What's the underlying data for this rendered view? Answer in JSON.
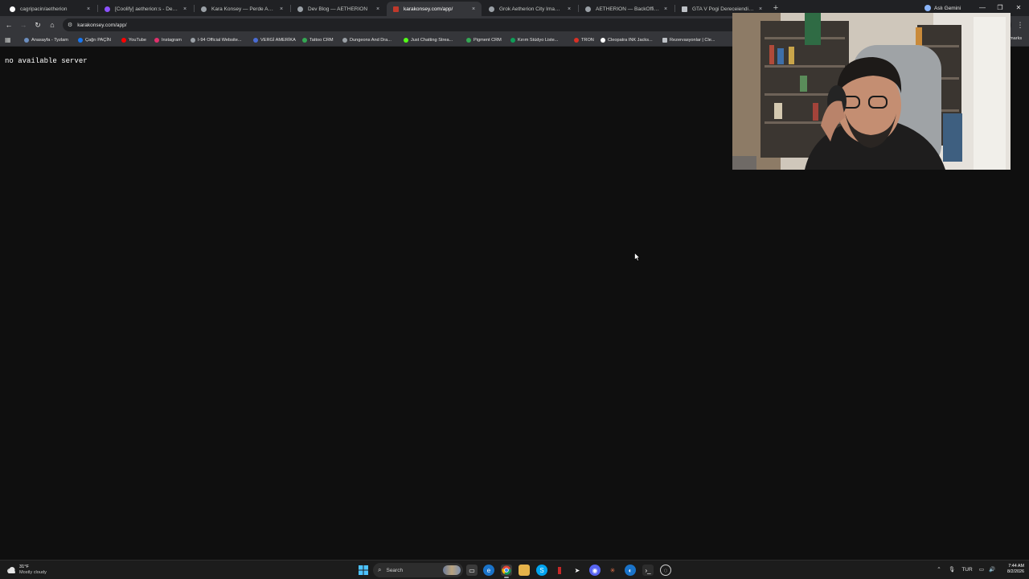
{
  "browser": {
    "tabs": [
      {
        "title": "cagripacin/aetherion",
        "icon": "github-icon",
        "color": "#ffffff",
        "active": false
      },
      {
        "title": "[Coolify] aetherion:s - Deploym",
        "icon": "coolify-icon",
        "color": "#8c52ff",
        "active": false
      },
      {
        "title": "Kara Konsey — Perde Aralanıy",
        "icon": "globe-icon",
        "color": "#9aa0a6",
        "active": false
      },
      {
        "title": "Dev Blog — AETHERION",
        "icon": "globe-icon",
        "color": "#9aa0a6",
        "active": false
      },
      {
        "title": "karakonsey.com/app/",
        "icon": "site-icon",
        "color": "#c0392b",
        "active": true
      },
      {
        "title": "Grok Aetherion City Image Pro",
        "icon": "globe-icon",
        "color": "#9aa0a6",
        "active": false
      },
      {
        "title": "AETHERION — BackOffice",
        "icon": "globe-icon",
        "color": "#9aa0a6",
        "active": false
      },
      {
        "title": "GTA V Pogi Dereceiendirmesi",
        "icon": "page-icon",
        "color": "#bdc1c6",
        "active": false
      }
    ],
    "tab_close_glyph": "×",
    "new_tab_glyph": "+",
    "profile_name": "Aslı Gemini",
    "url": "karakonsey.com/app/",
    "bookmarks": [
      {
        "label": "Anasayfa - Tyzlam",
        "color": "#6c8ebf"
      },
      {
        "label": "Çağrı PAÇİN",
        "color": "#1877f2"
      },
      {
        "label": "YouTube",
        "color": "#ff0000"
      },
      {
        "label": "Instagram",
        "color": "#e1306c"
      },
      {
        "label": "I-94 Official Website...",
        "color": "#9aa0a6"
      },
      {
        "label": "VERGİ AMERİKA",
        "color": "#4a6cd4"
      },
      {
        "label": "Tattoo CRM",
        "color": "#34a853"
      },
      {
        "label": "Dungeons And Dra...",
        "color": "#9aa0a6"
      },
      {
        "label": "Just Chatting Strea...",
        "color": "#53fc18"
      },
      {
        "label": "Pigment CRM",
        "color": "#34a853"
      },
      {
        "label": "Kırım Stüdyo Liste...",
        "color": "#0f9d58"
      },
      {
        "label": "TRON",
        "color": "#d93025"
      },
      {
        "label": "Cleopatra INK Jacks...",
        "color": "#ffffff"
      },
      {
        "label": "Rezervasyonlar | Cle...",
        "color": "#bdc1c6"
      }
    ],
    "bookmarks_more": "marks"
  },
  "page": {
    "message": "no available server"
  },
  "taskbar": {
    "weather_temp": "31°F",
    "weather_desc": "Mostly cloudy",
    "search_label": "Search",
    "language": "TUR",
    "time": "7:44 AM",
    "date": "8/2/2026"
  }
}
